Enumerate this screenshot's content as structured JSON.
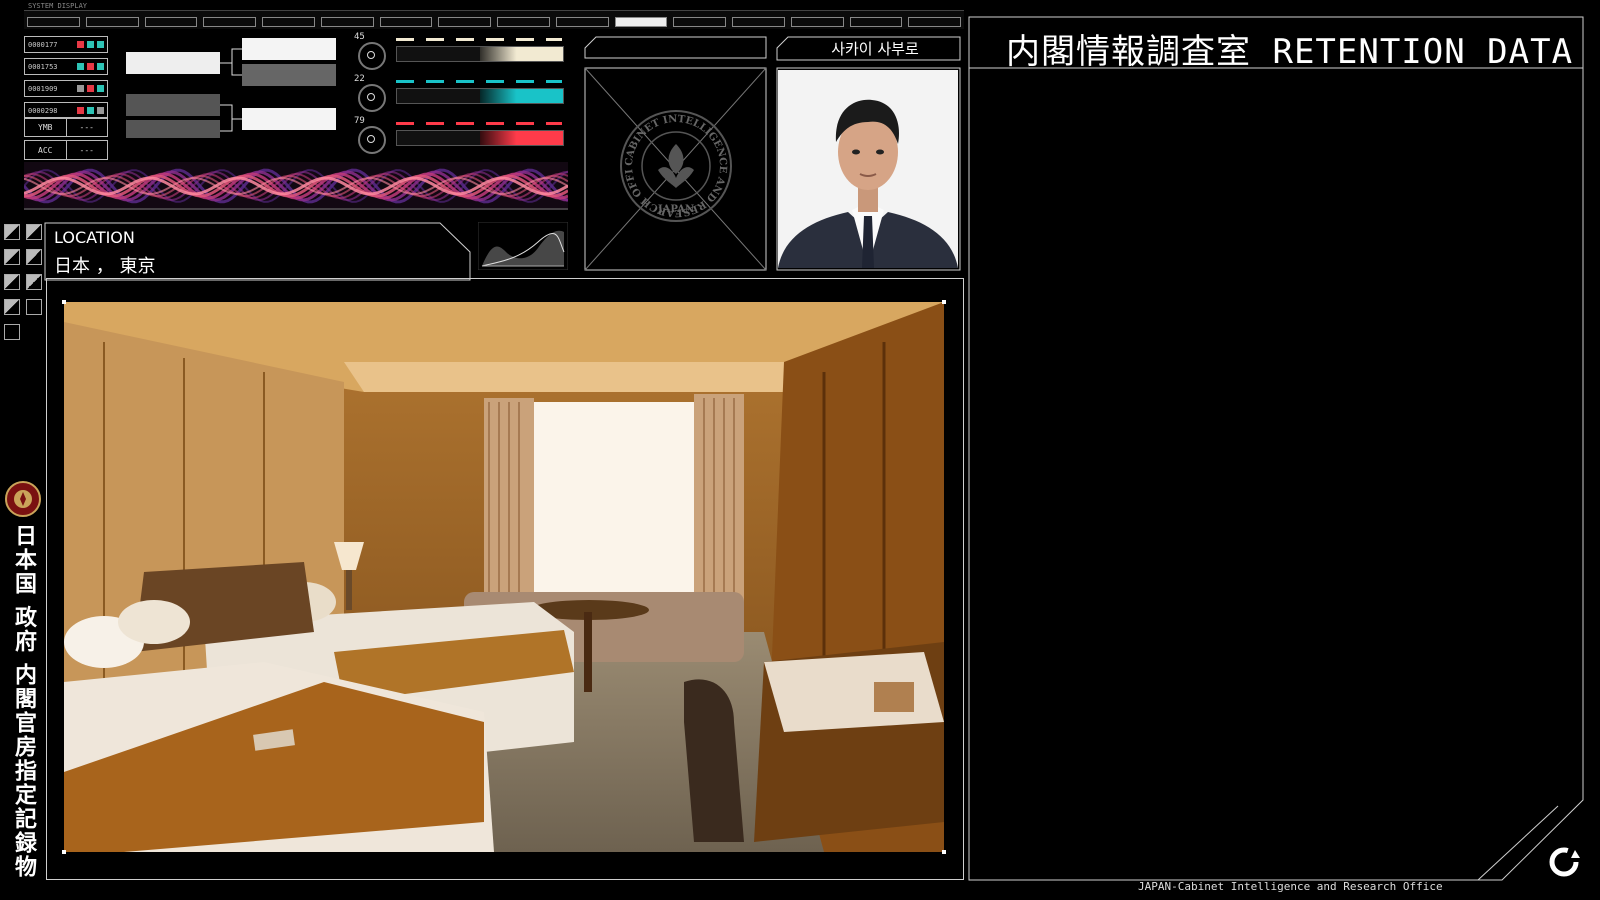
{
  "top_strip": {
    "label": "SYSTEM DISPLAY",
    "segment_count": 16,
    "highlighted_index": 10
  },
  "status_codes": [
    {
      "code": "0000177",
      "colors": [
        "#e63946",
        "#2ec4b6",
        "#2ec4b6"
      ]
    },
    {
      "code": "0001753",
      "colors": [
        "#2ec4b6",
        "#e63946",
        "#2ec4b6"
      ]
    },
    {
      "code": "0001909",
      "colors": [
        "#999999",
        "#e63946",
        "#2ec4b6"
      ]
    },
    {
      "code": "0000298",
      "colors": [
        "#e63946",
        "#2ec4b6",
        "#999999"
      ]
    }
  ],
  "key_values": [
    {
      "key": "YMB",
      "value": "---"
    },
    {
      "key": "ACC",
      "value": "---"
    }
  ],
  "dials": [
    {
      "label": "45",
      "accent": "#f2ead2"
    },
    {
      "label": "22",
      "accent": "#19c3c8"
    },
    {
      "label": "79",
      "accent": "#ff3b4a"
    }
  ],
  "location": {
    "label": "LOCATION",
    "value": "日本 ， 東京"
  },
  "seal": {
    "ring_text": "CABINET INTELLIGENCE AND RESEARCH OFFICE",
    "bottom_text": "JAPAN"
  },
  "person": {
    "name": "사카이 사부로"
  },
  "vertical_text": "日本国 政府 内閣官房指定記録物",
  "right_panel": {
    "title": "内閣情報調査室 RETENTION DATA"
  },
  "footer": {
    "text": "JAPAN-Cabinet Intelligence and Research Office"
  },
  "colors": {
    "cyan": "#19c3c8",
    "red": "#ff3b4a",
    "cream": "#f2ead2",
    "frame": "#cfcfcf"
  }
}
